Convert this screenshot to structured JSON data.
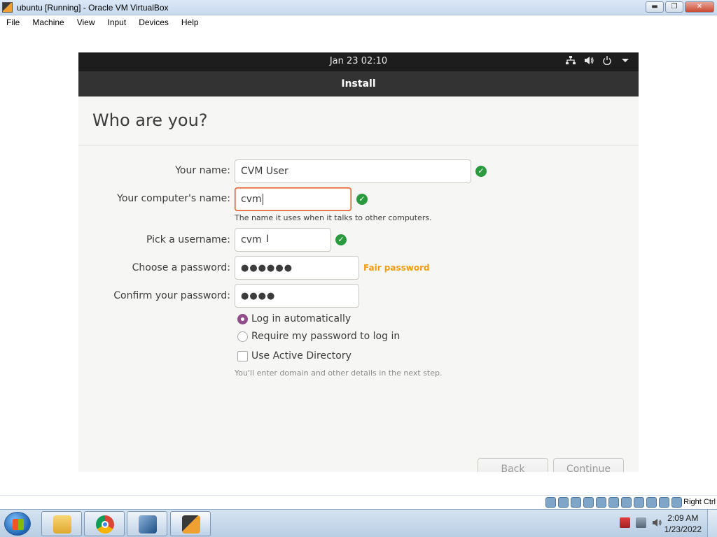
{
  "host": {
    "window_title": "ubuntu [Running] - Oracle VM VirtualBox",
    "window_buttons": {
      "minimize": "▬",
      "restore": "❐",
      "close": "✕"
    },
    "menu": [
      "File",
      "Machine",
      "View",
      "Input",
      "Devices",
      "Help"
    ],
    "host_key_label": "Right Ctrl",
    "clock_time": "2:09 AM",
    "clock_date": "1/23/2022"
  },
  "vm": {
    "topbar_datetime": "Jan 23  02:10",
    "tray_icons": [
      "network-icon",
      "volume-icon",
      "power-icon",
      "menu-arrow-icon"
    ],
    "headerbar_title": "Install",
    "page_title": "Who are you?",
    "form": {
      "your_name_label": "Your name:",
      "your_name_value": "CVM User",
      "computer_name_label": "Your computer's name:",
      "computer_name_value": "cvm",
      "computer_name_hint": "The name it uses when it talks to other computers.",
      "username_label": "Pick a username:",
      "username_value": "cvm",
      "password_label": "Choose a password:",
      "password_value": "●●●●●●",
      "password_strength": "Fair password",
      "confirm_label": "Confirm your password:",
      "confirm_value": "●●●●"
    },
    "login_options": {
      "auto_login": "Log in automatically",
      "require_password": "Require my password to log in",
      "selected": "auto_login"
    },
    "active_directory": {
      "label": "Use Active Directory",
      "checked": false,
      "hint": "You'll enter domain and other details in the next step."
    },
    "buttons": {
      "back": "Back",
      "continue": "Continue"
    }
  },
  "colors": {
    "accent_orange": "#e95420",
    "check_green": "#2b9a3f",
    "strength_orange": "#f39c12",
    "radio_purple": "#924d8b"
  }
}
